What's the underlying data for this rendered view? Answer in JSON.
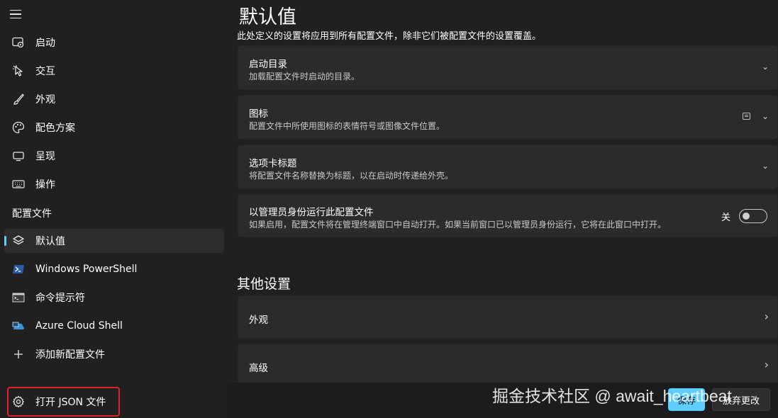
{
  "sidebar": {
    "items": [
      {
        "label": "启动",
        "icon": "startup-icon"
      },
      {
        "label": "交互",
        "icon": "interaction-icon"
      },
      {
        "label": "外观",
        "icon": "appearance-brush-icon"
      },
      {
        "label": "配色方案",
        "icon": "palette-icon"
      },
      {
        "label": "呈现",
        "icon": "monitor-icon"
      },
      {
        "label": "操作",
        "icon": "keyboard-icon"
      }
    ],
    "profiles_header": "配置文件",
    "profiles": [
      {
        "label": "默认值",
        "icon": "layers-icon",
        "selected": true
      },
      {
        "label": "Windows PowerShell",
        "icon": "powershell-icon"
      },
      {
        "label": "命令提示符",
        "icon": "cmd-icon"
      },
      {
        "label": "Azure Cloud Shell",
        "icon": "azure-icon"
      },
      {
        "label": "添加新配置文件",
        "icon": "plus-icon"
      }
    ],
    "open_json_label": "打开 JSON 文件"
  },
  "main": {
    "title": "默认值",
    "subtitle": "此处定义的设置将应用到所有配置文件，除非它们被配置文件的设置覆盖。",
    "cards": [
      {
        "title": "启动目录",
        "desc": "加载配置文件时启动的目录。"
      },
      {
        "title": "图标",
        "desc": "配置文件中所使用图标的表情符号或图像文件位置。"
      },
      {
        "title": "选项卡标题",
        "desc": "将配置文件名称替换为标题，以在启动时传递给外壳。"
      },
      {
        "title": "以管理员身份运行此配置文件",
        "desc": "如果启用，配置文件将在管理终端窗口中自动打开。如果当前窗口已以管理员身份运行，它将在此窗口中打开。",
        "toggle_label": "关"
      }
    ],
    "other_settings_title": "其他设置",
    "other_cards": [
      {
        "title": "外观"
      },
      {
        "title": "高级"
      }
    ]
  },
  "footer": {
    "save_label": "保存",
    "discard_label": "放弃更改"
  },
  "watermark": "掘金技术社区 @ await_heartbeat",
  "colors": {
    "accent": "#60cdff",
    "background": "#202020",
    "card": "#2b2b2b",
    "highlight_border": "#e0202a"
  }
}
